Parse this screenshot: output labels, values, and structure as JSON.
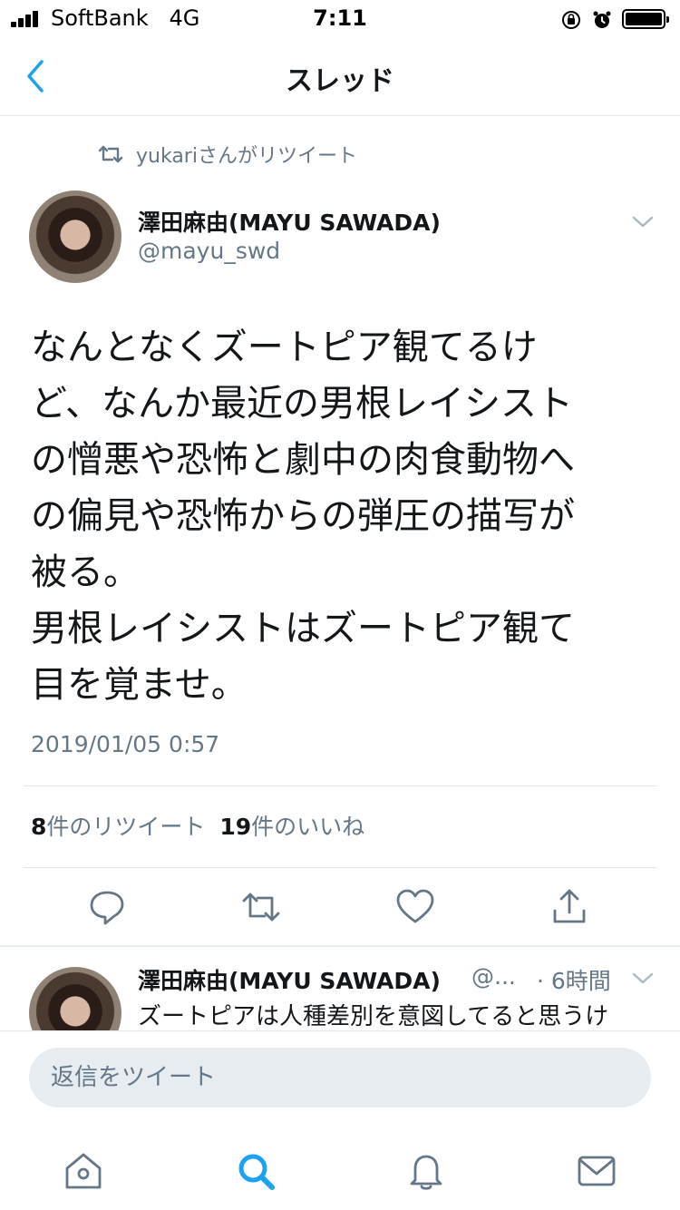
{
  "status_bar": {
    "carrier": "SoftBank",
    "network": "4G",
    "time": "7:11"
  },
  "nav": {
    "title": "スレッド",
    "back_icon": "chevron-left-icon"
  },
  "tweet": {
    "retweeted_by": "yukariさんがリツイート",
    "author_name": "澤田麻由(MAYU SAWADA)",
    "author_handle": "@mayu_swd",
    "text_lines": [
      "なんとなくズートピア観てるけ",
      "ど、なんか最近の男根レイシスト",
      "の憎悪や恐怖と劇中の肉食動物へ",
      "の偏見や恐怖からの弾圧の描写が",
      "被る。",
      "男根レイシストはズートピア観て",
      "目を覚ませ。"
    ],
    "timestamp": "2019/01/05 0:57",
    "retweet_count": "8",
    "retweet_label": "件のリツイート",
    "like_count": "19",
    "like_label": "件のいいね",
    "actions": [
      "reply-icon",
      "retweet-icon",
      "like-icon",
      "share-icon"
    ]
  },
  "reply": {
    "author_name": "澤田麻由(MAYU SAWADA)",
    "author_handle": "@...",
    "time": "· 6時間",
    "text": "ズートピアは人種差別を意図してると思うけ"
  },
  "composer": {
    "placeholder": "返信をツイート"
  },
  "tab_bar": [
    "home-icon",
    "search-icon",
    "notifications-icon",
    "messages-icon"
  ],
  "colors": {
    "accent": "#1da1f2",
    "secondary_text": "#657786",
    "primary_text": "#14171a",
    "divider": "#e1e8ed"
  }
}
